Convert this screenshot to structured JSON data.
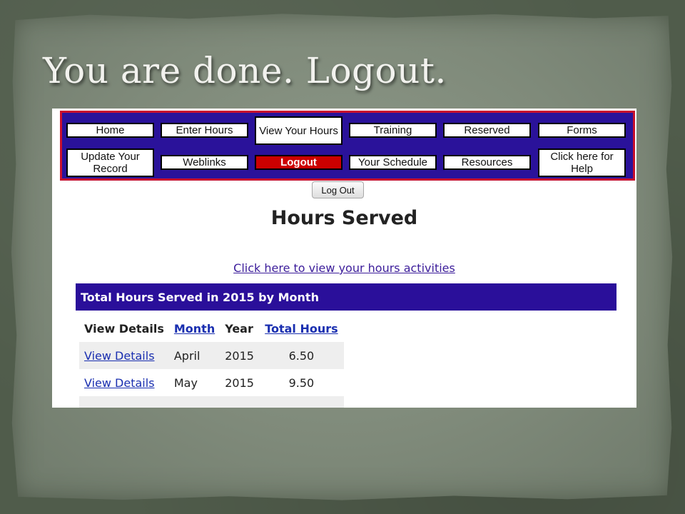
{
  "slide": {
    "title": "You are done. Logout."
  },
  "nav": {
    "buttons": [
      {
        "label": "Home"
      },
      {
        "label": "Enter Hours"
      },
      {
        "label": "View Your Hours"
      },
      {
        "label": "Training"
      },
      {
        "label": "Reserved"
      },
      {
        "label": "Forms"
      },
      {
        "label": "Update Your Record"
      },
      {
        "label": "Weblinks"
      },
      {
        "label": "Logout"
      },
      {
        "label": "Your Schedule"
      },
      {
        "label": "Resources"
      },
      {
        "label": "Click here for Help"
      }
    ]
  },
  "logout_button": {
    "label": "Log Out"
  },
  "page": {
    "heading": "Hours Served",
    "activities_link": "Click here to view your hours activities",
    "banner": "Total Hours Served in 2015 by Month"
  },
  "table": {
    "headers": [
      "View Details",
      "Month",
      "Year",
      "Total Hours"
    ],
    "rows": [
      [
        "View Details",
        "April",
        "2015",
        "6.50"
      ],
      [
        "View Details",
        "May",
        "2015",
        "9.50"
      ]
    ]
  },
  "colors": {
    "nav_background": "#2a129a",
    "nav_border": "#c8102e",
    "logout_highlight": "#cc0000",
    "banner": "#2a0f9a"
  }
}
